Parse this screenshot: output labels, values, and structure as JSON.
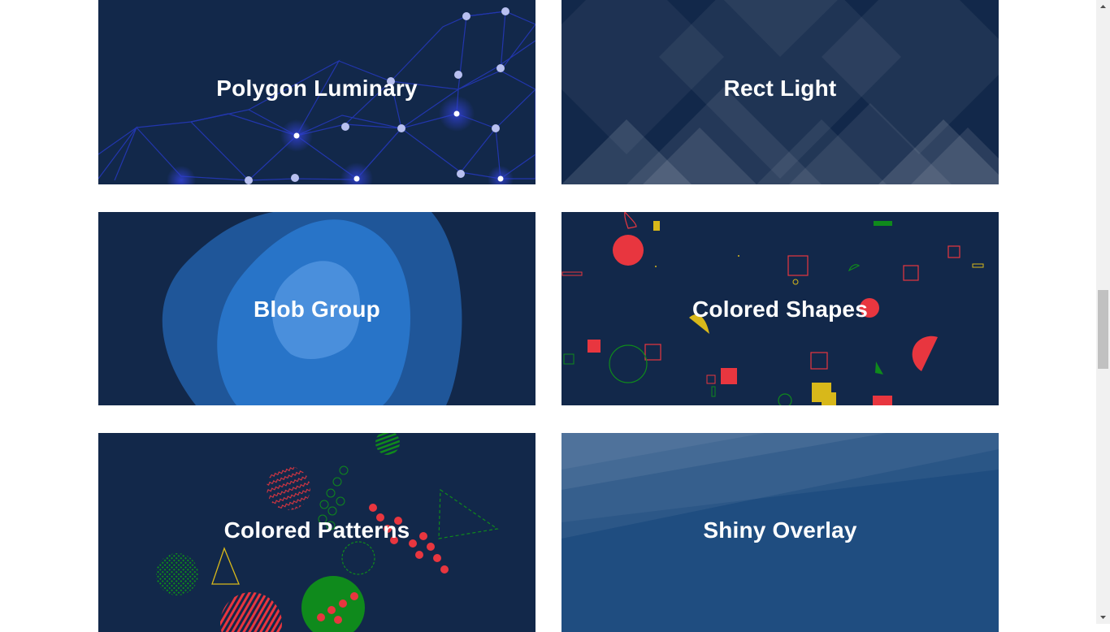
{
  "cards": [
    {
      "title": "Polygon Luminary"
    },
    {
      "title": "Rect Light"
    },
    {
      "title": "Blob Group"
    },
    {
      "title": "Colored Shapes"
    },
    {
      "title": "Colored Patterns"
    },
    {
      "title": "Shiny Overlay"
    }
  ],
  "colors": {
    "card_bg": "#12284a",
    "blue_light": "#4a8fdc",
    "blue_mid": "#2874c8",
    "red": "#e8363f",
    "green": "#0f8a1c",
    "yellow": "#d8b81a"
  },
  "scrollbar": {
    "position": 0.48
  }
}
